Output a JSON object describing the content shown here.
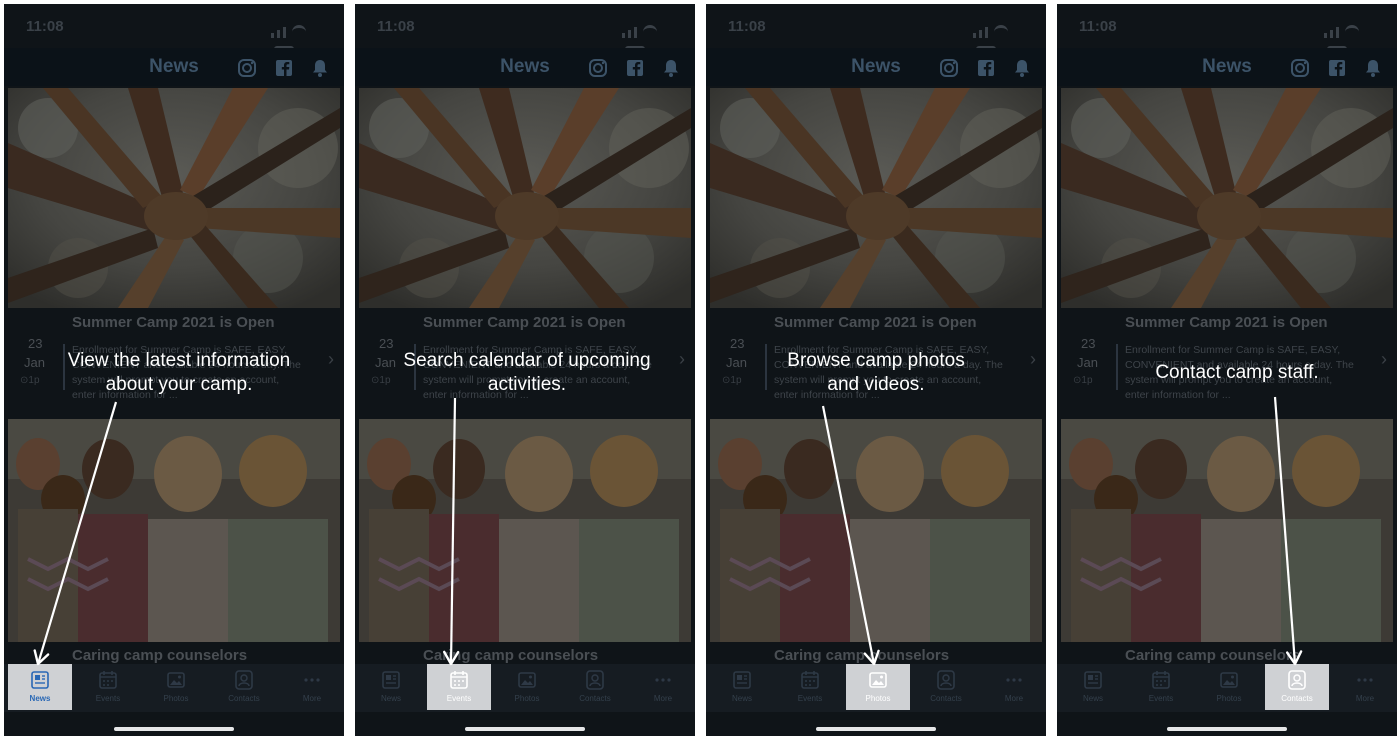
{
  "screens": [
    {
      "status_time": "11:08",
      "header_title": "News",
      "news_title": "Summer Camp 2021 is Open",
      "date_day": "23",
      "date_month": "Jan",
      "date_time": "⊙1p",
      "snippet": "Enrollment for Summer Camp is SAFE, EASY, CONVENIENT and available 24 hours a day. The system will prompt you to create an account, enter information for ...",
      "news2_title": "Caring camp counselors",
      "caption_line1": "View the latest information",
      "caption_line2": "about your camp.",
      "tabs": [
        {
          "label": "News",
          "icon": "newspaper-icon"
        },
        {
          "label": "Events",
          "icon": "calendar-icon"
        },
        {
          "label": "Photos",
          "icon": "photo-icon"
        },
        {
          "label": "Contacts",
          "icon": "contact-icon"
        },
        {
          "label": "More",
          "icon": "more-icon"
        }
      ],
      "active_tab": 0
    },
    {
      "status_time": "11:08",
      "header_title": "News",
      "news_title": "Summer Camp 2021 is Open",
      "date_day": "23",
      "date_month": "Jan",
      "date_time": "⊙1p",
      "snippet": "Enrollment for Summer Camp is SAFE, EASY, CONVENIENT and available 24 hours a day. The system will prompt you to create an account, enter information for ...",
      "news2_title": "Caring camp counselors",
      "caption_line1": "Search calendar of upcoming",
      "caption_line2": "activities.",
      "tabs": [
        {
          "label": "News",
          "icon": "newspaper-icon"
        },
        {
          "label": "Events",
          "icon": "calendar-icon"
        },
        {
          "label": "Photos",
          "icon": "photo-icon"
        },
        {
          "label": "Contacts",
          "icon": "contact-icon"
        },
        {
          "label": "More",
          "icon": "more-icon"
        }
      ],
      "active_tab": 1
    },
    {
      "status_time": "11:08",
      "header_title": "News",
      "news_title": "Summer Camp 2021 is Open",
      "date_day": "23",
      "date_month": "Jan",
      "date_time": "⊙1p",
      "snippet": "Enrollment for Summer Camp is SAFE, EASY, CONVENIENT and available 24 hours a day. The system will prompt you to create an account, enter information for ...",
      "news2_title": "Caring camp counselors",
      "caption_line1": "Browse camp photos",
      "caption_line2": "and videos.",
      "tabs": [
        {
          "label": "News",
          "icon": "newspaper-icon"
        },
        {
          "label": "Events",
          "icon": "calendar-icon"
        },
        {
          "label": "Photos",
          "icon": "photo-icon"
        },
        {
          "label": "Contacts",
          "icon": "contact-icon"
        },
        {
          "label": "More",
          "icon": "more-icon"
        }
      ],
      "active_tab": 2
    },
    {
      "status_time": "11:08",
      "header_title": "News",
      "news_title": "Summer Camp 2021 is Open",
      "date_day": "23",
      "date_month": "Jan",
      "date_time": "⊙1p",
      "snippet": "Enrollment for Summer Camp is SAFE, EASY, CONVENIENT and available 24 hours a day. The system will prompt you to create an account, enter information for ...",
      "news2_title": "Caring camp counselors",
      "caption_line1": "Contact camp staff.",
      "caption_line2": "",
      "tabs": [
        {
          "label": "News",
          "icon": "newspaper-icon"
        },
        {
          "label": "Events",
          "icon": "calendar-icon"
        },
        {
          "label": "Photos",
          "icon": "photo-icon"
        },
        {
          "label": "Contacts",
          "icon": "contact-icon"
        },
        {
          "label": "More",
          "icon": "more-icon"
        }
      ],
      "active_tab": 3
    }
  ],
  "colors": {
    "overlay_bg": "#0f1418",
    "active_tab_bg": "#cfd1d4",
    "active_label_news": "#2a68b5",
    "caption_text": "#ffffff"
  }
}
